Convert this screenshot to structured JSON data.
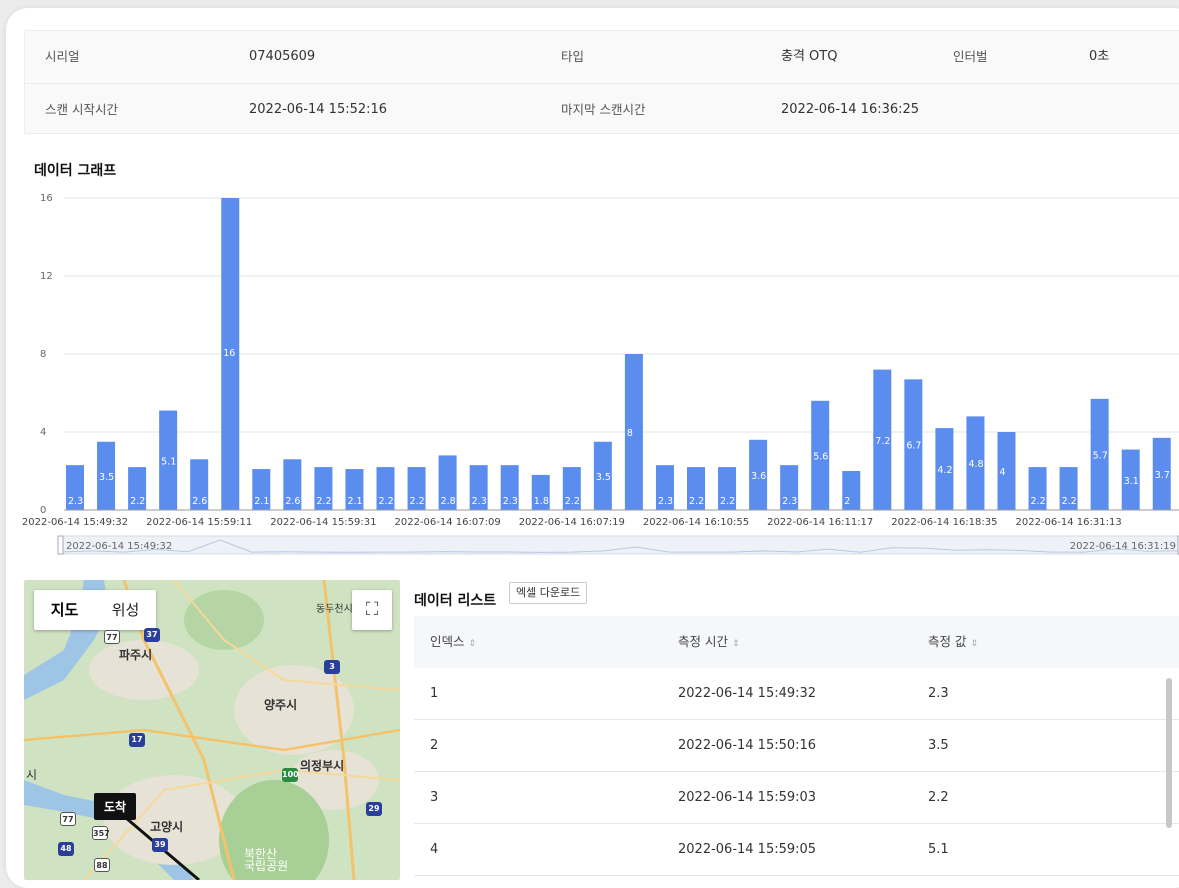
{
  "info": {
    "serial_label": "시리얼",
    "serial_value": "07405609",
    "type_label": "타입",
    "type_value": "충격 OTQ",
    "interval_label": "인터벌",
    "interval_value": "0초",
    "scan_start_label": "스캔 시작시간",
    "scan_start_value": "2022-06-14 15:52:16",
    "last_scan_label": "마지막 스캔시간",
    "last_scan_value": "2022-06-14 16:36:25"
  },
  "graph_title": "데이터 그래프",
  "chart_data": {
    "type": "bar",
    "title": "",
    "xlabel": "",
    "ylabel": "",
    "ylim": [
      0,
      16
    ],
    "yticks": [
      0,
      4,
      8,
      12,
      16
    ],
    "grid": true,
    "bar_color": "#5b8def",
    "values": [
      2.3,
      3.5,
      2.2,
      5.1,
      2.6,
      16,
      2.1,
      2.6,
      2.2,
      2.1,
      2.2,
      2.2,
      2.8,
      2.3,
      2.3,
      1.8,
      2.2,
      3.5,
      8,
      2.3,
      2.2,
      2.2,
      3.6,
      2.3,
      5.6,
      2,
      7.2,
      6.7,
      4.2,
      4.8,
      4,
      2.2,
      2.2,
      5.7,
      3.1,
      3.7
    ],
    "x_tick_labels": [
      {
        "index": 0,
        "label": "2022-06-14 15:49:32"
      },
      {
        "index": 4,
        "label": "2022-06-14 15:59:11"
      },
      {
        "index": 8,
        "label": "2022-06-14 15:59:31"
      },
      {
        "index": 12,
        "label": "2022-06-14 16:07:09"
      },
      {
        "index": 16,
        "label": "2022-06-14 16:07:19"
      },
      {
        "index": 20,
        "label": "2022-06-14 16:10:55"
      },
      {
        "index": 24,
        "label": "2022-06-14 16:11:17"
      },
      {
        "index": 28,
        "label": "2022-06-14 16:18:35"
      },
      {
        "index": 32,
        "label": "2022-06-14 16:31:13"
      }
    ],
    "zoom_start_label": "2022-06-14 15:49:32",
    "zoom_end_label": "2022-06-14 16:31:19"
  },
  "map": {
    "map_button": "지도",
    "satellite_button": "위성",
    "fullscreen_icon": "fullscreen-icon",
    "arrival_label": "도착",
    "places": {
      "paju": "파주시",
      "yangju": "양주시",
      "uijeongbu": "의정부시",
      "goyang": "고양시",
      "bukhansan": "북한산\n국립공원",
      "dongducheon": "동두천시",
      "si": "시"
    },
    "routes": [
      "37",
      "77",
      "3",
      "17",
      "100",
      "29",
      "77",
      "357",
      "39",
      "48",
      "88"
    ]
  },
  "list": {
    "title": "데이터 리스트",
    "excel_button": "엑셀 다운로드",
    "columns": [
      "인덱스",
      "측정 시간",
      "측정 값"
    ],
    "rows": [
      [
        "1",
        "2022-06-14 15:49:32",
        "2.3"
      ],
      [
        "2",
        "2022-06-14 15:50:16",
        "3.5"
      ],
      [
        "3",
        "2022-06-14 15:59:03",
        "2.2"
      ],
      [
        "4",
        "2022-06-14 15:59:05",
        "5.1"
      ]
    ]
  }
}
